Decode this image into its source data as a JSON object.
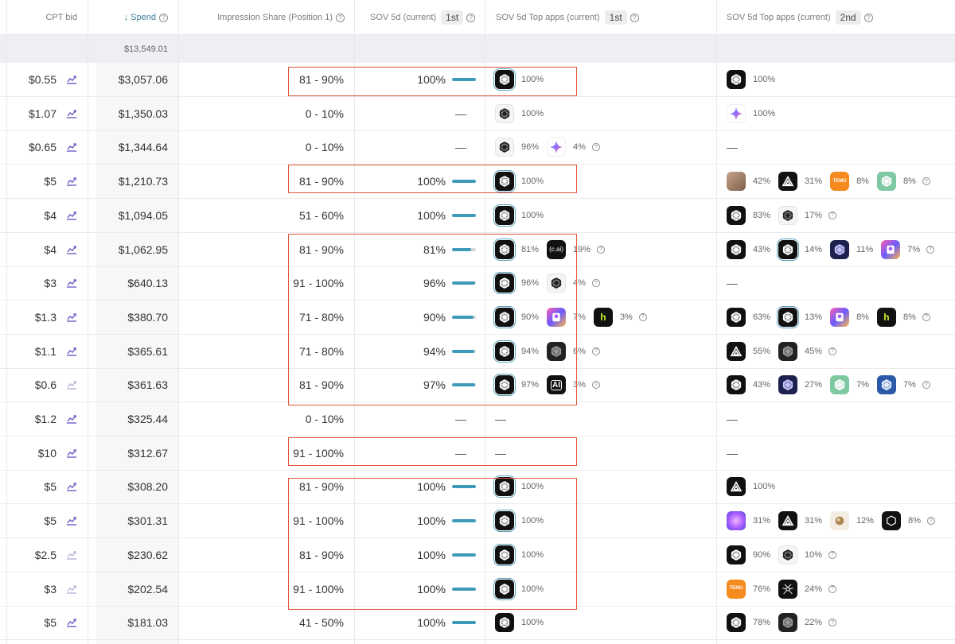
{
  "headers": {
    "cpt_bid": "CPT bid",
    "spend": "↓ Spend",
    "impression_share": "Impression Share (Position 1)",
    "sov5d": "SOV 5d (current)",
    "sov5d_rank": "1st",
    "sov5d_top": "SOV 5d Top apps (current)",
    "sov5d_top_rank": "1st",
    "sov5d_top2": "SOV 5d Top apps (current)",
    "sov5d_top2_rank": "2nd",
    "help": "?"
  },
  "total_spend": "$13,549.01",
  "dash": "—",
  "rows": [
    {
      "bid": "$0.55",
      "spend": "$3,057.06",
      "share": "81 - 90%",
      "sov": "100%",
      "sov_fill": 1.0,
      "trend": "strong",
      "top1": [
        {
          "icon": "gpt-black",
          "pct": "100%",
          "sel": true
        }
      ],
      "top2": [
        {
          "icon": "gpt-black",
          "pct": "100%"
        }
      ]
    },
    {
      "bid": "$1.07",
      "spend": "$1,350.03",
      "share": "0 - 10%",
      "sov": "",
      "sov_fill": 0,
      "trend": "strong",
      "top1": [
        {
          "icon": "gpt-white",
          "pct": "100%"
        }
      ],
      "top2": [
        {
          "icon": "gemini",
          "pct": "100%"
        }
      ]
    },
    {
      "bid": "$0.65",
      "spend": "$1,344.64",
      "share": "0 - 10%",
      "sov": "",
      "sov_fill": 0,
      "trend": "strong",
      "top1": [
        {
          "icon": "gpt-white",
          "pct": "96%"
        },
        {
          "icon": "gemini",
          "pct": "4%",
          "tip": true
        }
      ],
      "top2": []
    },
    {
      "bid": "$5",
      "spend": "$1,210.73",
      "share": "81 - 90%",
      "sov": "100%",
      "sov_fill": 1.0,
      "trend": "strong",
      "top1": [
        {
          "icon": "gpt-black",
          "pct": "100%",
          "sel": true
        }
      ],
      "top2": [
        {
          "icon": "photo",
          "pct": "42%"
        },
        {
          "icon": "delta",
          "pct": "31%"
        },
        {
          "icon": "temu",
          "pct": "8%"
        },
        {
          "icon": "green",
          "pct": "8%",
          "tip": true
        }
      ]
    },
    {
      "bid": "$4",
      "spend": "$1,094.05",
      "share": "51 - 60%",
      "sov": "100%",
      "sov_fill": 1.0,
      "trend": "strong",
      "top1": [
        {
          "icon": "gpt-black",
          "pct": "100%",
          "sel": true
        }
      ],
      "top2": [
        {
          "icon": "gpt-black",
          "pct": "83%"
        },
        {
          "icon": "gpt-white",
          "pct": "17%",
          "tip": true
        }
      ]
    },
    {
      "bid": "$4",
      "spend": "$1,062.95",
      "share": "81 - 90%",
      "sov": "81%",
      "sov_fill": 0.81,
      "trend": "strong",
      "top1": [
        {
          "icon": "gpt-black",
          "pct": "81%",
          "sel": true
        },
        {
          "icon": "cai",
          "pct": "19%",
          "tip": true
        }
      ],
      "top2": [
        {
          "icon": "gpt-black",
          "pct": "43%"
        },
        {
          "icon": "gpt-black",
          "pct": "14%",
          "sel": true
        },
        {
          "icon": "navy",
          "pct": "11%"
        },
        {
          "icon": "perplex",
          "pct": "7%",
          "tip": true
        }
      ]
    },
    {
      "bid": "$3",
      "spend": "$640.13",
      "share": "91 - 100%",
      "sov": "96%",
      "sov_fill": 0.96,
      "trend": "strong",
      "top1": [
        {
          "icon": "gpt-black",
          "pct": "96%",
          "sel": true
        },
        {
          "icon": "gpt-white",
          "pct": "4%",
          "tip": true
        }
      ],
      "top2": []
    },
    {
      "bid": "$1.3",
      "spend": "$380.70",
      "share": "71 - 80%",
      "sov": "90%",
      "sov_fill": 0.9,
      "trend": "strong",
      "top1": [
        {
          "icon": "gpt-black",
          "pct": "90%",
          "sel": true
        },
        {
          "icon": "perplex",
          "pct": "7%"
        },
        {
          "icon": "hogge",
          "pct": "3%",
          "tip": true
        }
      ],
      "top2": [
        {
          "icon": "gpt-black",
          "pct": "63%"
        },
        {
          "icon": "gpt-black",
          "pct": "13%",
          "sel": true
        },
        {
          "icon": "perplex",
          "pct": "8%"
        },
        {
          "icon": "hogge",
          "pct": "8%",
          "tip": true
        }
      ]
    },
    {
      "bid": "$1.1",
      "spend": "$365.61",
      "share": "71 - 80%",
      "sov": "94%",
      "sov_fill": 0.94,
      "trend": "strong",
      "top1": [
        {
          "icon": "gpt-black",
          "pct": "94%",
          "sel": true
        },
        {
          "icon": "dark",
          "pct": "6%",
          "tip": true
        }
      ],
      "top2": [
        {
          "icon": "delta",
          "pct": "55%"
        },
        {
          "icon": "dark",
          "pct": "45%",
          "tip": true
        }
      ]
    },
    {
      "bid": "$0.6",
      "spend": "$361.63",
      "share": "81 - 90%",
      "sov": "97%",
      "sov_fill": 0.97,
      "trend": "faint",
      "top1": [
        {
          "icon": "gpt-black",
          "pct": "97%",
          "sel": true
        },
        {
          "icon": "ai",
          "pct": "3%",
          "tip": true
        }
      ],
      "top2": [
        {
          "icon": "gpt-black",
          "pct": "43%"
        },
        {
          "icon": "navy",
          "pct": "27%"
        },
        {
          "icon": "green",
          "pct": "7%"
        },
        {
          "icon": "blue",
          "pct": "7%",
          "tip": true
        }
      ]
    },
    {
      "bid": "$1.2",
      "spend": "$325.44",
      "share": "0 - 10%",
      "sov": "",
      "sov_fill": 0,
      "trend": "strong",
      "top1": [],
      "top1_dash": true,
      "top2": []
    },
    {
      "bid": "$10",
      "spend": "$312.67",
      "share": "91 - 100%",
      "sov": "",
      "sov_fill": 0,
      "trend": "strong",
      "top1": [],
      "top1_dash": true,
      "top2": []
    },
    {
      "bid": "$5",
      "spend": "$308.20",
      "share": "81 - 90%",
      "sov": "100%",
      "sov_fill": 1.0,
      "trend": "strong",
      "top1": [
        {
          "icon": "gpt-black",
          "pct": "100%",
          "sel": true
        }
      ],
      "top2": [
        {
          "icon": "delta",
          "pct": "100%"
        }
      ]
    },
    {
      "bid": "$5",
      "spend": "$301.31",
      "share": "91 - 100%",
      "sov": "100%",
      "sov_fill": 1.0,
      "trend": "strong",
      "top1": [
        {
          "icon": "gpt-black",
          "pct": "100%",
          "sel": true
        }
      ],
      "top2": [
        {
          "icon": "orb",
          "pct": "31%"
        },
        {
          "icon": "delta",
          "pct": "31%"
        },
        {
          "icon": "ball",
          "pct": "12%"
        },
        {
          "icon": "hex",
          "pct": "8%",
          "tip": true
        }
      ]
    },
    {
      "bid": "$2.5",
      "spend": "$230.62",
      "share": "81 - 90%",
      "sov": "100%",
      "sov_fill": 1.0,
      "trend": "faint",
      "top1": [
        {
          "icon": "gpt-black",
          "pct": "100%",
          "sel": true
        }
      ],
      "top2": [
        {
          "icon": "gpt-black",
          "pct": "90%"
        },
        {
          "icon": "gpt-white",
          "pct": "10%",
          "tip": true
        }
      ]
    },
    {
      "bid": "$3",
      "spend": "$202.54",
      "share": "91 - 100%",
      "sov": "100%",
      "sov_fill": 1.0,
      "trend": "faint",
      "top1": [
        {
          "icon": "gpt-black",
          "pct": "100%",
          "sel": true
        }
      ],
      "top2": [
        {
          "icon": "temu",
          "pct": "76%"
        },
        {
          "icon": "spider",
          "pct": "24%",
          "tip": true
        }
      ]
    },
    {
      "bid": "$5",
      "spend": "$181.03",
      "share": "41 - 50%",
      "sov": "100%",
      "sov_fill": 1.0,
      "trend": "strong",
      "top1": [
        {
          "icon": "gpt-black",
          "pct": "100%"
        }
      ],
      "top2": [
        {
          "icon": "gpt-black",
          "pct": "78%"
        },
        {
          "icon": "dark",
          "pct": "22%",
          "tip": true
        }
      ]
    }
  ],
  "icon_text": {
    "cai": "c.ai",
    "ai": "AI",
    "hogge": "h",
    "temu": "TEMU"
  },
  "colors": {
    "accent": "#3d9bb9",
    "highlight_box": "#e1563a",
    "spend_bg": "#f6f7f9"
  }
}
